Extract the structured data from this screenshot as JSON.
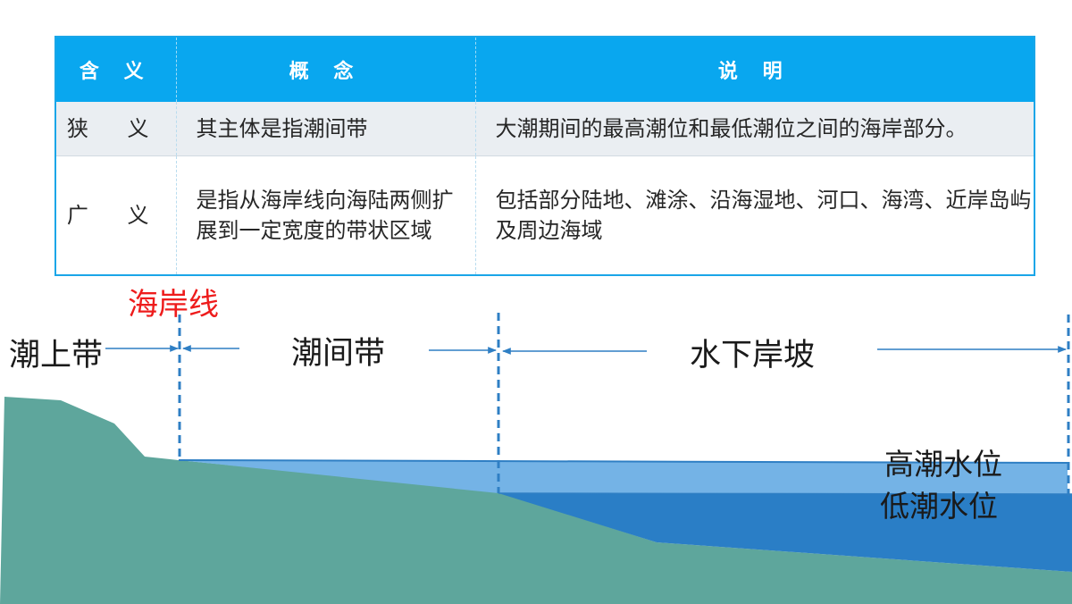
{
  "table": {
    "headers": [
      "含 义",
      "概 念",
      "说 明"
    ],
    "rows": [
      {
        "meaning": "狭 义",
        "concept": "其主体是指潮间带",
        "description": "大潮期间的最高潮位和最低潮位之间的海岸部分。"
      },
      {
        "meaning": "广 义",
        "concept": "是指从海岸线向海陆两侧扩展到一定宽度的带状区域",
        "description": "包括部分陆地、滩涂、沿海湿地、河口、海湾、近岸岛屿及周边海域"
      }
    ]
  },
  "diagram": {
    "coastline_label": "海岸线",
    "supratidal_label": "潮上带",
    "intertidal_label": "潮间带",
    "subtidal_slope_label": "水下岸坡",
    "high_tide_label": "高潮水位",
    "low_tide_label": "低潮水位",
    "colors": {
      "header_bg": "#09a7ef",
      "coastline_red": "#ee1c1c",
      "land": "#5ea69c",
      "high_water": "#74b3e6",
      "low_water": "#2a7ec6",
      "marker_line": "#2f7fc4"
    }
  }
}
